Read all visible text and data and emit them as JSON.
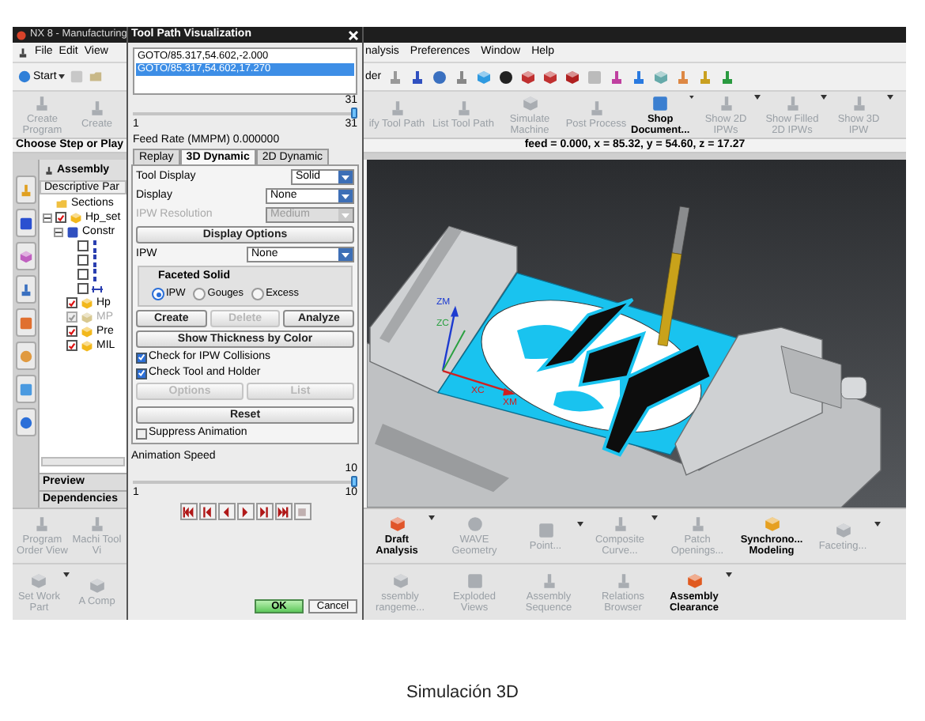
{
  "window": {
    "title": "NX 8 - Manufacturing"
  },
  "menu_left": [
    "File",
    "Edit",
    "View"
  ],
  "menu_right": [
    "nalysis",
    "Preferences",
    "Window",
    "Help"
  ],
  "start_button": "Start",
  "toolbar_fragment": "der",
  "ribbon_left": [
    {
      "label": "Create Program",
      "disabled": true
    },
    {
      "label": "Create",
      "disabled": true
    }
  ],
  "ribbon_right": [
    {
      "label": "ify Tool Path",
      "disabled": true,
      "has_menu": false
    },
    {
      "label": "List Tool Path",
      "disabled": true,
      "has_menu": false
    },
    {
      "label": "Simulate Machine",
      "disabled": true,
      "has_menu": false
    },
    {
      "label": "Post Process",
      "disabled": true,
      "has_menu": false
    },
    {
      "label": "Shop Document...",
      "disabled": false,
      "has_menu": true
    },
    {
      "label": "Show 2D IPWs",
      "disabled": true,
      "has_menu": true
    },
    {
      "label": "Show Filled 2D IPWs",
      "disabled": true,
      "has_menu": true
    },
    {
      "label": "Show 3D IPW",
      "disabled": true,
      "has_menu": true
    }
  ],
  "prompt": "Choose Step or Play",
  "status": "feed = 0.000, x = 85.32, y = 54.60, z = 17.27",
  "navigator": {
    "title": "Assembly",
    "column": "Descriptive Par",
    "tree": [
      {
        "label": "Sections",
        "kind": "folder"
      },
      {
        "label": "Hp_set",
        "kind": "assembly",
        "checked": true,
        "disabled": false,
        "expanded": true,
        "children": [
          {
            "label": "Constr",
            "kind": "constraints",
            "expanded": true,
            "children": [
              {
                "kind": "constraint",
                "checked": false,
                "disabled": false
              },
              {
                "kind": "constraint",
                "checked": false,
                "disabled": false
              },
              {
                "kind": "constraint",
                "checked": false,
                "disabled": false
              },
              {
                "kind": "distance",
                "checked": false,
                "disabled": false
              }
            ]
          },
          {
            "label": "Hp",
            "kind": "part",
            "checked": true,
            "disabled": false
          },
          {
            "label": "MP",
            "kind": "part",
            "checked": true,
            "disabled": true
          },
          {
            "label": "Pre",
            "kind": "part",
            "checked": true,
            "disabled": false
          },
          {
            "label": "MIL",
            "kind": "part",
            "checked": true,
            "disabled": false
          }
        ]
      }
    ],
    "panels": [
      "Preview",
      "Dependencies"
    ]
  },
  "dialog": {
    "title": "Tool Path Visualization",
    "lines": [
      {
        "text": "GOTO/85.317,54.602,-2.000",
        "selected": false
      },
      {
        "text": "GOTO/85.317,54.602,17.270",
        "selected": true
      }
    ],
    "step_slider": {
      "value": "31",
      "min": "1",
      "max": "31",
      "level": 1
    },
    "feed_rate": "Feed Rate (MMPM) 0.000000",
    "tabs": [
      {
        "label": "Replay",
        "selected": false
      },
      {
        "label": "3D Dynamic",
        "selected": true
      },
      {
        "label": "2D Dynamic",
        "selected": false
      }
    ],
    "fields": [
      {
        "label": "Tool Display",
        "value": "Solid",
        "disabled": false
      },
      {
        "label": "Display",
        "value": "None",
        "disabled": false
      },
      {
        "label": "IPW Resolution",
        "value": "Medium",
        "disabled": true
      }
    ],
    "display_options": "Display Options",
    "ipw": {
      "label": "IPW",
      "value": "None"
    },
    "faceted": {
      "title": "Faceted Solid",
      "options": [
        {
          "label": "IPW",
          "selected": true
        },
        {
          "label": "Gouges",
          "selected": false
        },
        {
          "label": "Excess",
          "selected": false
        }
      ],
      "buttons": [
        {
          "label": "Create",
          "disabled": false
        },
        {
          "label": "Delete",
          "disabled": true
        },
        {
          "label": "Analyze",
          "disabled": false
        }
      ]
    },
    "thickness_button": "Show Thickness by Color",
    "checks": [
      {
        "label": "Check for IPW Collisions",
        "checked": true
      },
      {
        "label": "Check Tool and Holder",
        "checked": true
      }
    ],
    "check_buttons": [
      {
        "label": "Options",
        "disabled": true
      },
      {
        "label": "List",
        "disabled": true
      }
    ],
    "reset": "Reset",
    "suppress": {
      "label": "Suppress Animation",
      "checked": false
    },
    "speed": {
      "label": "Animation Speed",
      "value": "10",
      "min": "1",
      "max": "10",
      "level": 1
    },
    "playback": [
      {
        "kind": "first",
        "disabled": false
      },
      {
        "kind": "step-back",
        "disabled": false
      },
      {
        "kind": "reverse",
        "disabled": false
      },
      {
        "kind": "play",
        "disabled": false
      },
      {
        "kind": "step-forward",
        "disabled": false
      },
      {
        "kind": "last",
        "disabled": false
      },
      {
        "kind": "stop",
        "disabled": true
      }
    ],
    "ok": "OK",
    "cancel": "Cancel"
  },
  "viewport": {
    "axis_labels": [
      "ZM",
      "ZC",
      "XC",
      "XM"
    ]
  },
  "bottom_left": {
    "row_1": [
      {
        "label": "Program Order View",
        "disabled": true
      },
      {
        "label": "Machi Tool Vi",
        "disabled": true
      }
    ],
    "row_2": [
      {
        "label": "Set Work Part",
        "disabled": true,
        "has_menu": true
      },
      {
        "label": "A Comp",
        "disabled": true,
        "has_menu": false
      }
    ]
  },
  "bottom_right": {
    "row_1": [
      {
        "label": "Draft Analysis",
        "disabled": false,
        "has_menu": true
      },
      {
        "label": "WAVE Geometry",
        "disabled": true,
        "has_menu": false
      },
      {
        "label": "Point...",
        "disabled": true,
        "has_menu": true
      },
      {
        "label": "Composite Curve...",
        "disabled": true,
        "has_menu": true
      },
      {
        "label": "Patch Openings...",
        "disabled": true,
        "has_menu": false
      },
      {
        "label": "Synchrono... Modeling",
        "disabled": false,
        "has_menu": false
      },
      {
        "label": "Faceting...",
        "disabled": true,
        "has_menu": true
      }
    ],
    "row_2": [
      {
        "label": "ssembly rangeme...",
        "disabled": true,
        "has_menu": false
      },
      {
        "label": "Exploded Views",
        "disabled": true,
        "has_menu": false
      },
      {
        "label": "Assembly Sequence",
        "disabled": true,
        "has_menu": false
      },
      {
        "label": "Relations Browser",
        "disabled": true,
        "has_menu": false
      },
      {
        "label": "Assembly Clearance",
        "disabled": false,
        "has_menu": true
      }
    ]
  },
  "caption": "Simulación 3D"
}
